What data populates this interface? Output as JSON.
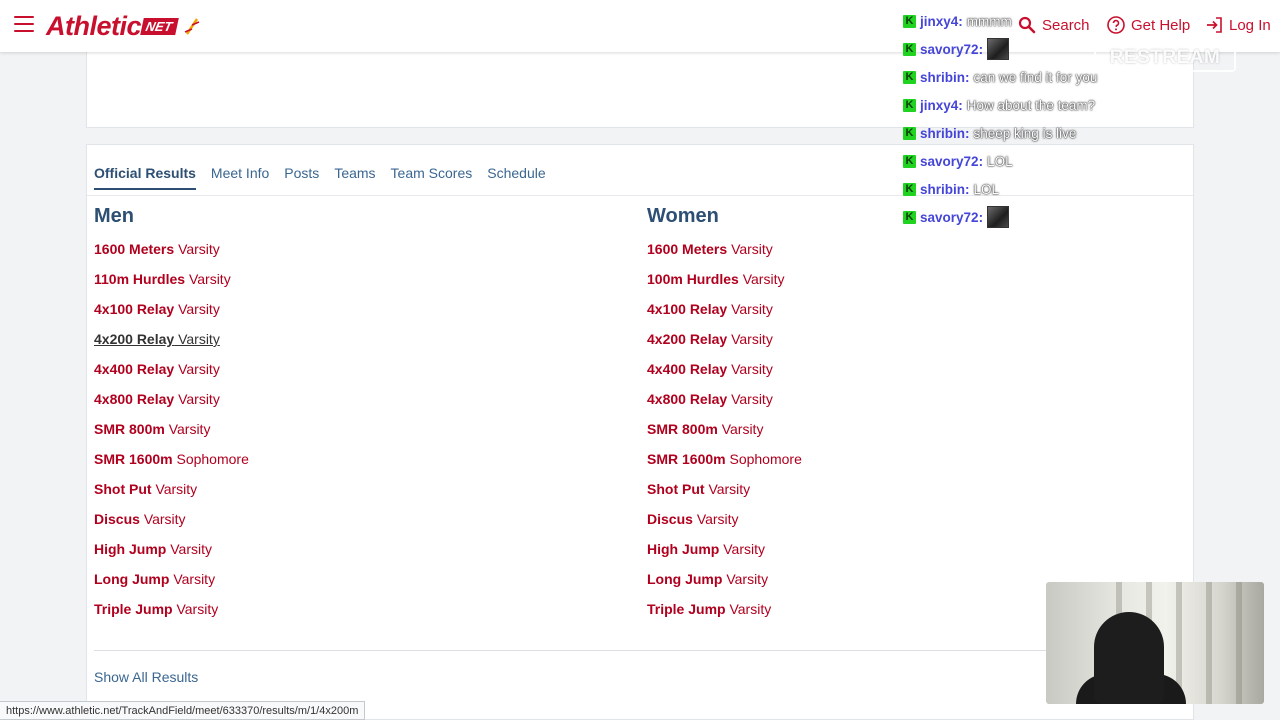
{
  "header": {
    "logo_word": "Athletic",
    "logo_net": "NET",
    "search_label": "Search",
    "help_label": "Get Help",
    "login_label": "Log In"
  },
  "tabs": [
    {
      "label": "Official Results",
      "active": true
    },
    {
      "label": "Meet Info"
    },
    {
      "label": "Posts"
    },
    {
      "label": "Teams"
    },
    {
      "label": "Team Scores"
    },
    {
      "label": "Schedule"
    }
  ],
  "men": {
    "heading": "Men",
    "events": [
      {
        "name": "1600 Meters",
        "division": "Varsity"
      },
      {
        "name": "110m Hurdles",
        "division": "Varsity"
      },
      {
        "name": "4x100 Relay",
        "division": "Varsity"
      },
      {
        "name": "4x200 Relay",
        "division": "Varsity"
      },
      {
        "name": "4x400 Relay",
        "division": "Varsity"
      },
      {
        "name": "4x800 Relay",
        "division": "Varsity"
      },
      {
        "name": "SMR 800m",
        "division": "Varsity"
      },
      {
        "name": "SMR 1600m",
        "division": "Sophomore"
      },
      {
        "name": "Shot Put",
        "division": "Varsity"
      },
      {
        "name": "Discus",
        "division": "Varsity"
      },
      {
        "name": "High Jump",
        "division": "Varsity"
      },
      {
        "name": "Long Jump",
        "division": "Varsity"
      },
      {
        "name": "Triple Jump",
        "division": "Varsity"
      }
    ]
  },
  "women": {
    "heading": "Women",
    "events": [
      {
        "name": "1600 Meters",
        "division": "Varsity"
      },
      {
        "name": "100m Hurdles",
        "division": "Varsity"
      },
      {
        "name": "4x100 Relay",
        "division": "Varsity"
      },
      {
        "name": "4x200 Relay",
        "division": "Varsity"
      },
      {
        "name": "4x400 Relay",
        "division": "Varsity"
      },
      {
        "name": "4x800 Relay",
        "division": "Varsity"
      },
      {
        "name": "SMR 800m",
        "division": "Varsity"
      },
      {
        "name": "SMR 1600m",
        "division": "Sophomore"
      },
      {
        "name": "Shot Put",
        "division": "Varsity"
      },
      {
        "name": "Discus",
        "division": "Varsity"
      },
      {
        "name": "High Jump",
        "division": "Varsity"
      },
      {
        "name": "Long Jump",
        "division": "Varsity"
      },
      {
        "name": "Triple Jump",
        "division": "Varsity"
      }
    ]
  },
  "show_all_label": "Show All Results",
  "status_url": "https://www.athletic.net/TrackAndField/meet/633370/results/m/1/4x200m",
  "overlay": {
    "restream_label": "RESTREAM",
    "chat": [
      {
        "user": "jinxy4",
        "message": "mmmm"
      },
      {
        "user": "savory72",
        "message": "",
        "emote": true
      },
      {
        "user": "shribin",
        "message": "can we find it for you"
      },
      {
        "user": "jinxy4",
        "message": "How about the team?"
      },
      {
        "user": "shribin",
        "message": "sheep king is live"
      },
      {
        "user": "savory72",
        "message": "LOL"
      },
      {
        "user": "shribin",
        "message": "LOL"
      },
      {
        "user": "savory72",
        "message": "",
        "emote": true
      }
    ]
  },
  "colors": {
    "brand_red": "#c8102e",
    "event_red": "#b0001e",
    "link_blue": "#3a6691",
    "heading_navy": "#2d4f73"
  }
}
